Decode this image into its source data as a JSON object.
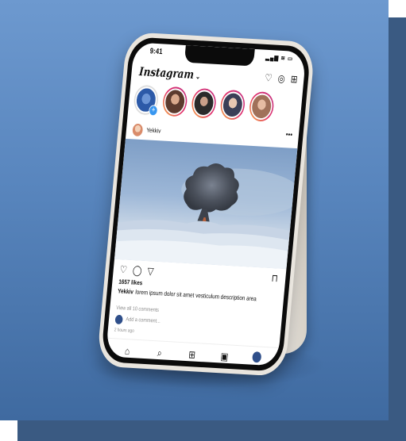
{
  "status_bar": {
    "time": "9:41",
    "icons": "▂▄▆ ≋ ▭"
  },
  "header": {
    "logo": "Instagram",
    "logo_chevron": "⌄",
    "icons": [
      "heart-icon",
      "messenger-icon",
      "new-post-icon"
    ]
  },
  "stories": [
    {
      "kind": "own",
      "color": "#2d5aa8"
    },
    {
      "kind": "user",
      "color": "#5c3b2e"
    },
    {
      "kind": "user",
      "color": "#2a2a2a"
    },
    {
      "kind": "user",
      "color": "#3b3f57"
    },
    {
      "kind": "user",
      "color": "#a0715a"
    }
  ],
  "post": {
    "username": "Yekkiv",
    "more": "•••",
    "likes": "1657 likes",
    "caption_user": "Yekkiv",
    "caption_text": "lorem ipsum dolor sit amet vesticulum description area",
    "view_all": "View all 10 comments",
    "add_comment": "Add a comment...",
    "time_ago": "2 hours ago"
  },
  "glyphs": {
    "heart": "♡",
    "messenger": "◎",
    "new_post": "⊞",
    "like": "♡",
    "comment": "◯",
    "share": "▽",
    "save": "⊓",
    "home": "⌂",
    "search": "⌕",
    "add": "⊞",
    "reels": "▣"
  }
}
